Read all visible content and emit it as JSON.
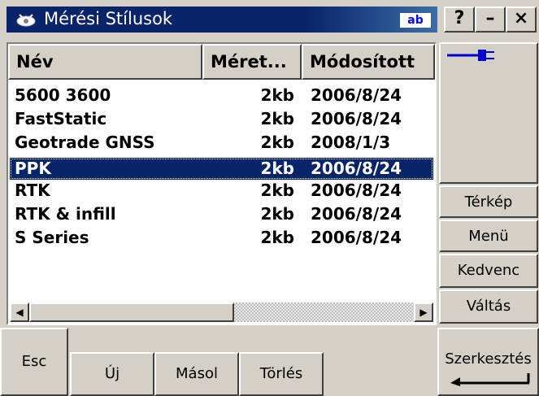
{
  "window": {
    "title": "Mérési Stílusok",
    "input_indicator": "ab",
    "help_label": "?",
    "minimize_label": "–",
    "close_label": "×",
    "app_icon": "satellite-icon"
  },
  "list": {
    "columns": [
      "Név",
      "Méret...",
      "Módosított"
    ],
    "rows": [
      {
        "name": "5600 3600",
        "size": "2kb",
        "modified": "2006/8/24",
        "selected": false
      },
      {
        "name": "FastStatic",
        "size": "2kb",
        "modified": "2006/8/24",
        "selected": false
      },
      {
        "name": "Geotrade GNSS",
        "size": "2kb",
        "modified": "2008/1/3",
        "selected": false
      },
      {
        "name": "PPK",
        "size": "2kb",
        "modified": "2006/8/24",
        "selected": true
      },
      {
        "name": "RTK",
        "size": "2kb",
        "modified": "2006/8/24",
        "selected": false
      },
      {
        "name": "RTK & infill",
        "size": "2kb",
        "modified": "2006/8/24",
        "selected": false
      },
      {
        "name": "S Series",
        "size": "2kb",
        "modified": "2006/8/24",
        "selected": false
      }
    ]
  },
  "scrollbar": {
    "left_arrow": "◀",
    "right_arrow": "▶"
  },
  "side_panel": {
    "connection_icon": "plug-icon",
    "map_label": "Térkép",
    "menu_label": "Menü",
    "favorite_label": "Kedvenc",
    "switch_label": "Váltás"
  },
  "bottom": {
    "esc_label": "Esc",
    "new_label": "Új",
    "copy_label": "Másol",
    "delete_label": "Törlés",
    "edit_label": "Szerkesztés",
    "enter_icon": "enter-arrow-icon"
  },
  "colors": {
    "titlebar": "#0a246a",
    "selection": "#0a246a",
    "face": "#d4d0c8",
    "plug": "#0000cc"
  }
}
